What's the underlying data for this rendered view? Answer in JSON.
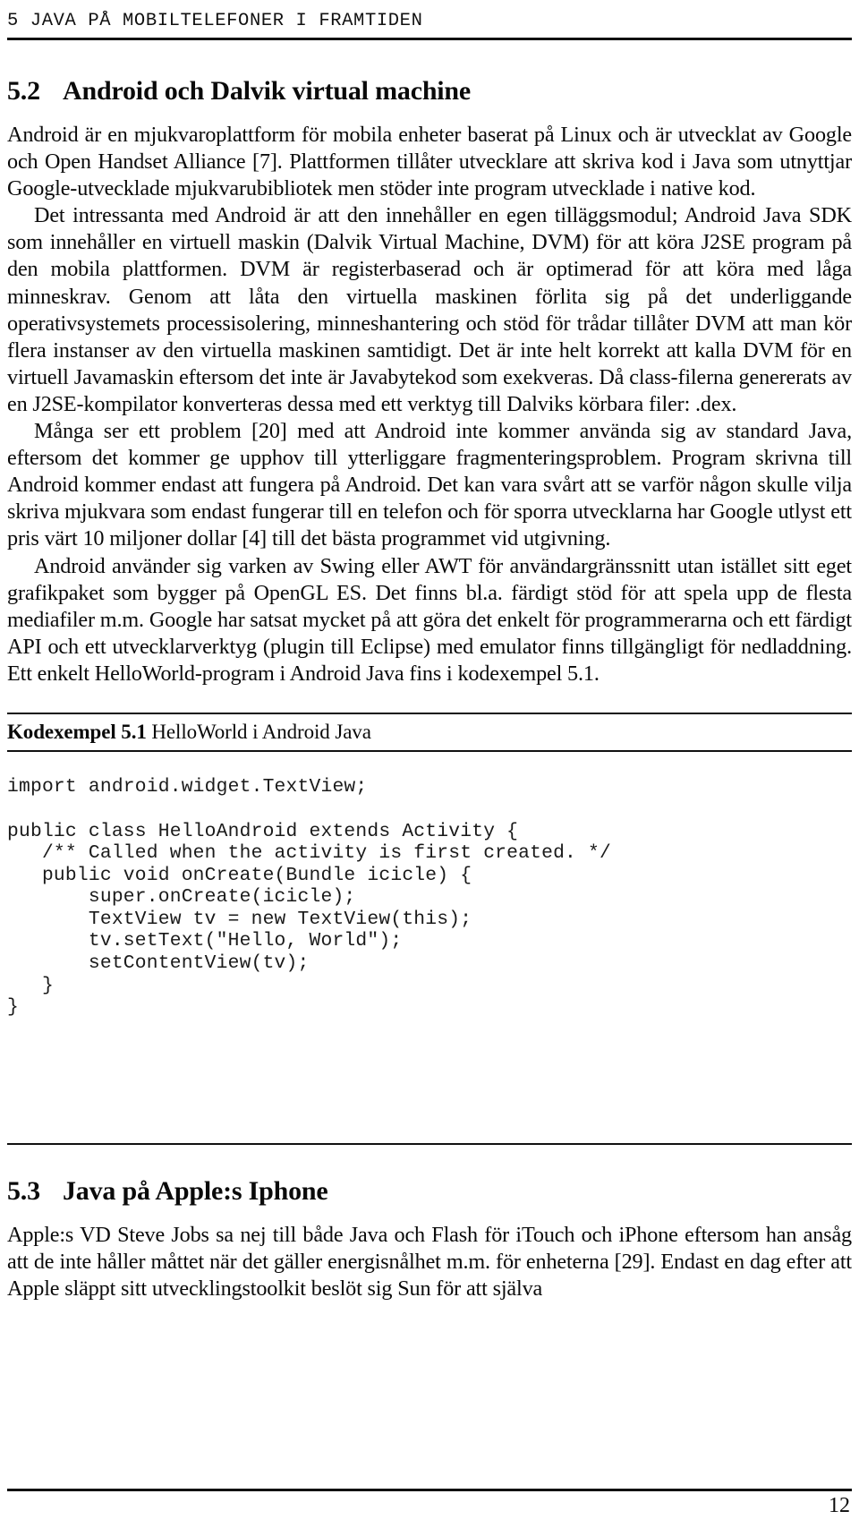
{
  "header": {
    "running_head": "5  JAVA PÅ MOBILTELEFONER I FRAMTIDEN"
  },
  "sections": {
    "s52": {
      "number": "5.2",
      "title": "Android och Dalvik virtual machine"
    },
    "s53": {
      "number": "5.3",
      "title": "Java på Apple:s Iphone"
    }
  },
  "paragraphs": {
    "p1": "Android är en mjukvaroplattform för mobila enheter baserat på Linux och är utvecklat av Google och Open Handset Alliance [7]. Plattformen tillåter utvecklare att skriva kod i Java som utnyttjar Google-utvecklade mjukvarubibliotek men stöder inte program utvecklade i native kod.",
    "p2": "Det intressanta med Android är att den innehåller en egen tilläggsmodul; Android Java SDK som innehåller en virtuell maskin (Dalvik Virtual Machine, DVM) för att köra J2SE program på den mobila plattformen. DVM är registerbaserad och är optimerad för att köra med låga minneskrav. Genom att låta den virtuella maskinen förlita sig på det underliggande operativsystemets processisolering, minneshantering och stöd för trådar tillåter DVM att man kör flera instanser av den virtuella maskinen samtidigt. Det är inte helt korrekt att kalla DVM för en virtuell Javamaskin eftersom det inte är Javabytekod som exekveras. Då class-filerna genererats av en J2SE-kompilator konverteras dessa med ett verktyg till Dalviks körbara filer: .dex.",
    "p3": "Många ser ett problem [20] med att Android inte kommer använda sig av standard Java, eftersom det kommer ge upphov till ytterliggare fragmenteringsproblem. Program skrivna till Android kommer endast att fungera på Android. Det kan vara svårt att se varför någon skulle vilja skriva mjukvara som endast fungerar till en telefon och för sporra utvecklarna har Google utlyst ett pris värt 10 miljoner dollar [4] till det bästa programmet vid utgivning.",
    "p4": "Android använder sig varken av Swing eller AWT för användargränssnitt utan istället sitt eget grafikpaket som bygger på OpenGL ES. Det finns bl.a. färdigt stöd för att spela upp de flesta mediafiler m.m. Google har satsat mycket på att göra det enkelt för programmerarna och ett färdigt API och ett utvecklarverktyg (plugin till Eclipse) med emulator finns tillgängligt för nedladdning. Ett enkelt HelloWorld-program i Android Java fins i kodexempel 5.1.",
    "p5": "Apple:s VD Steve Jobs sa nej till både Java och Flash för iTouch och iPhone eftersom han ansåg att de inte håller måttet när det gäller energisnålhet m.m. för enheterna [29]. Endast en dag efter att Apple släppt sitt utvecklingstoolkit beslöt sig Sun för att själva"
  },
  "listing": {
    "caption_label": "Kodexempel 5.1",
    "caption_text": "HelloWorld i Android Java",
    "code": "import android.widget.TextView;\n\npublic class HelloAndroid extends Activity {\n   /** Called when the activity is first created. */\n   public void onCreate(Bundle icicle) {\n       super.onCreate(icicle);\n       TextView tv = new TextView(this);\n       tv.setText(\"Hello, World\");\n       setContentView(tv);\n   }\n}"
  },
  "footer": {
    "page_number": "12"
  }
}
